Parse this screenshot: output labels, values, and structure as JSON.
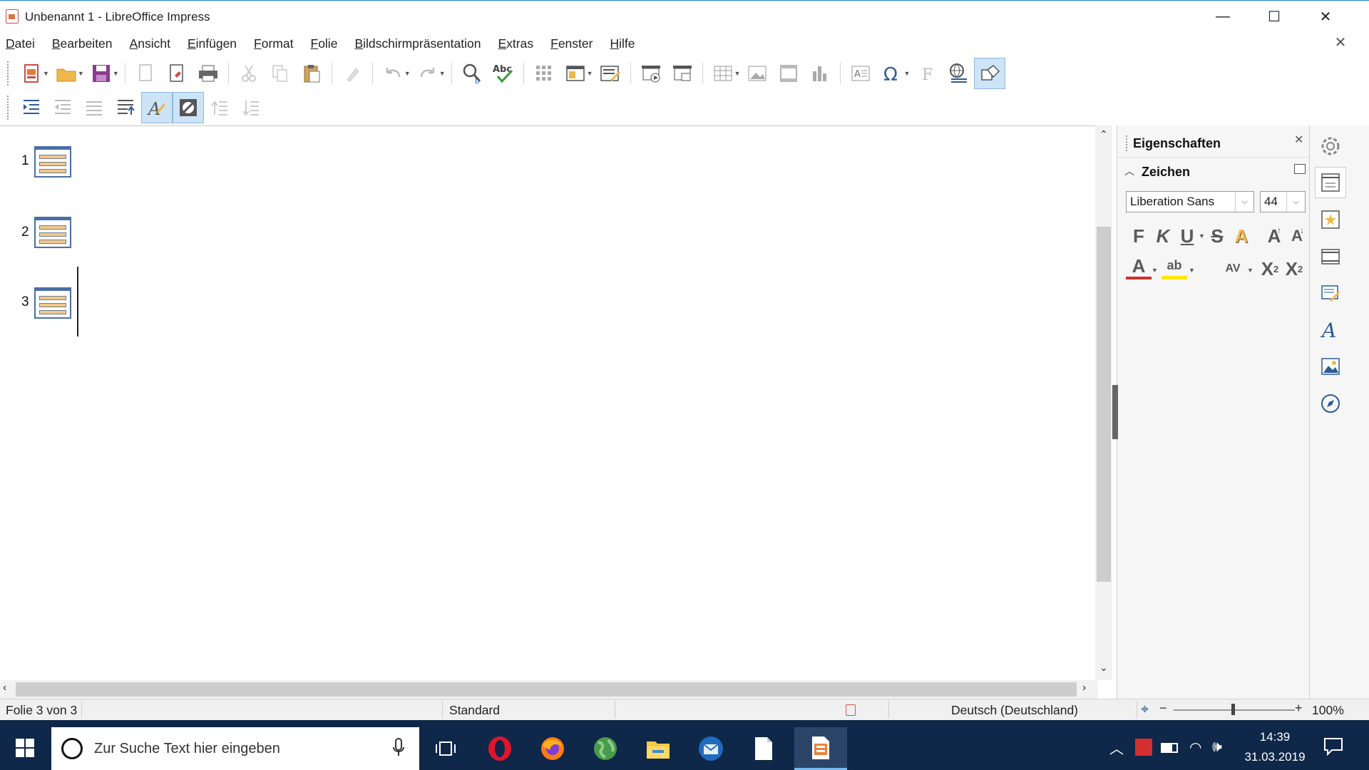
{
  "window": {
    "title": "Unbenannt 1 - LibreOffice Impress",
    "minimize": "—",
    "maximize": "☐",
    "close": "✕",
    "doc_close": "✕"
  },
  "menu": [
    "Datei",
    "Bearbeiten",
    "Ansicht",
    "Einfügen",
    "Format",
    "Folie",
    "Bildschirmpräsentation",
    "Extras",
    "Fenster",
    "Hilfe"
  ],
  "toolbar1": {
    "icons": [
      "new-document",
      "open",
      "save",
      "export",
      "export-pdf",
      "print",
      "cut",
      "copy",
      "paste",
      "clone-formatting",
      "undo",
      "redo",
      "find-replace",
      "spelling",
      "grid",
      "display-views",
      "master-slide",
      "start-presentation",
      "start-from-current",
      "table",
      "image",
      "media",
      "chart",
      "textbox",
      "special-character",
      "fontwork",
      "hyperlink",
      "basic-shapes"
    ]
  },
  "toolbar2": {
    "icons": [
      "demote",
      "promote",
      "move-down",
      "move-up",
      "first-level",
      "formatting-on",
      "black-white",
      "collapse",
      "expand"
    ]
  },
  "slides": [
    {
      "number": "1"
    },
    {
      "number": "2"
    },
    {
      "number": "3"
    }
  ],
  "sidebar": {
    "title": "Eigenschaften",
    "close": "✕",
    "section": "Zeichen",
    "font_name": "Liberation Sans",
    "font_size": "44",
    "format_buttons": {
      "bold": "F",
      "italic": "K",
      "underline": "U",
      "strike": "S",
      "shadow": "A",
      "grow": "A",
      "shrink": "A",
      "font_color": "A",
      "highlight": "ab",
      "spacing": "AV",
      "superscript": "X",
      "superscript_sup": "2",
      "subscript": "X",
      "subscript_sub": "2"
    },
    "deck_icons": [
      "properties",
      "slide-transition",
      "animation",
      "master-slides",
      "styles",
      "gallery",
      "navigator"
    ]
  },
  "status": {
    "slide": "Folie 3 von 3",
    "master": "Standard",
    "language": "Deutsch (Deutschland)",
    "zoom": "100%",
    "zoom_level": 1.0
  },
  "taskbar": {
    "search_placeholder": "Zur Suche Text hier eingeben",
    "time": "14:39",
    "date": "31.03.2019",
    "apps": [
      "opera",
      "firefox",
      "earth",
      "file-explorer",
      "thunderbird",
      "notepad",
      "impress"
    ]
  },
  "colors": {
    "accent": "#1c7fd1",
    "taskbar": "#0f2748",
    "opera": "#e0152a",
    "firefox": "#ff7a1a",
    "font_color_red": "#d32f2f",
    "highlight_yellow": "#ffe600"
  }
}
